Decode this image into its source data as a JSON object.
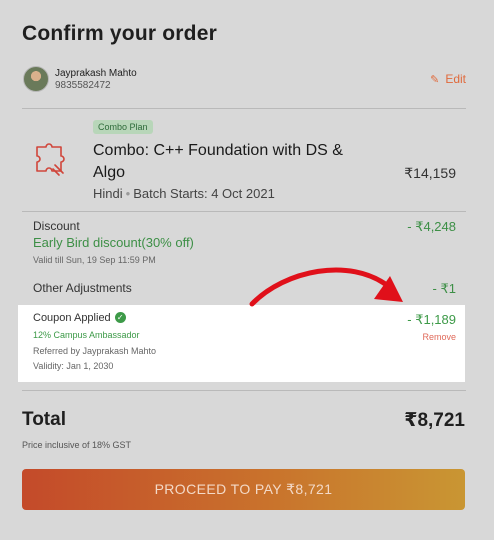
{
  "header": {
    "title": "Confirm your order"
  },
  "user": {
    "name": "Jayprakash Mahto",
    "phone": "9835582472",
    "edit_label": "Edit"
  },
  "course": {
    "plan_badge": "Combo Plan",
    "name": "Combo: C++ Foundation with DS & Algo",
    "price": "₹14,159",
    "language": "Hindi",
    "batch": "Batch Starts: 4 Oct 2021"
  },
  "discount": {
    "label": "Discount",
    "name": "Early Bird discount(30% off)",
    "valid": "Valid till Sun, 19 Sep 11:59 PM",
    "amount": "- ₹4,248"
  },
  "adjustments": {
    "label": "Other Adjustments",
    "amount": "- ₹1"
  },
  "coupon": {
    "label": "Coupon Applied",
    "name": "12% Campus Ambassador",
    "referred": "Referred by Jayprakash Mahto",
    "validity": "Validity: Jan 1, 2030",
    "amount": "- ₹1,189",
    "remove_label": "Remove"
  },
  "total": {
    "label": "Total",
    "amount": "₹8,721",
    "note": "Price inclusive of 18% GST"
  },
  "cta": {
    "label": "PROCEED TO PAY ₹8,721"
  },
  "colors": {
    "accent": "#e06a3c",
    "discount_green": "#3d8f46",
    "arrow_red": "#e0101a"
  }
}
